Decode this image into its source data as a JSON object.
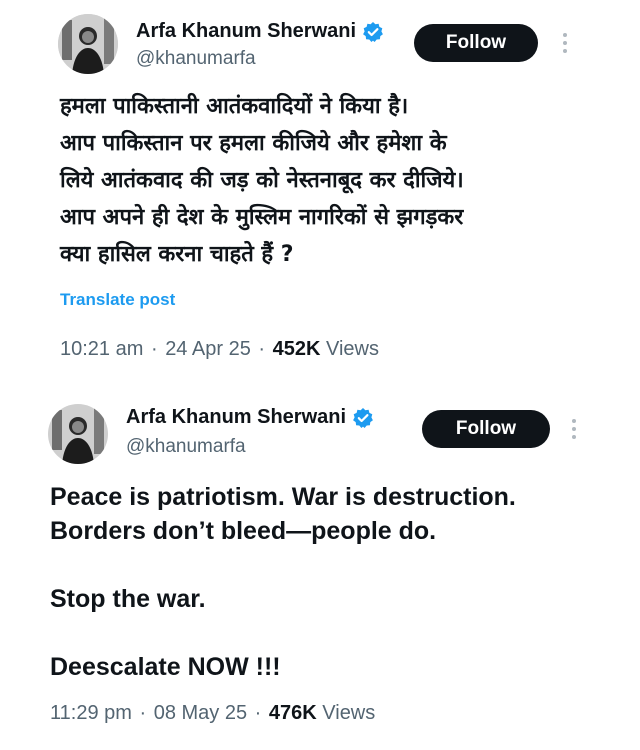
{
  "tweets": [
    {
      "author": {
        "display_name": "Arfa Khanum Sherwani",
        "handle": "@khanumarfa",
        "verified": true,
        "verified_color": "#1d9bf0"
      },
      "follow_label": "Follow",
      "text_lines": [
        "हमला पाकिस्तानी आतंकवादियों ने किया है।",
        "आप पाकिस्तान पर हमला कीजिये और हमेशा के",
        "लिये आतंकवाद की जड़ को नेस्तनाबूद कर दीजिये।",
        "आप अपने ही देश के मुस्लिम नागरिकों से झगड़कर",
        "क्या हासिल करना चाहते हैं ?"
      ],
      "translate_label": "Translate post",
      "time": "10:21 am",
      "date": "24 Apr 25",
      "views_count": "452K",
      "views_label": "Views"
    },
    {
      "author": {
        "display_name": "Arfa Khanum Sherwani",
        "handle": "@khanumarfa",
        "verified": true,
        "verified_color": "#1d9bf0"
      },
      "follow_label": "Follow",
      "text_lines": [
        "Peace is patriotism. War is destruction.",
        "Borders don’t bleed—people do.",
        "",
        "Stop the war.",
        "",
        "Deescalate NOW !!!"
      ],
      "time": "11:29 pm",
      "date": "08 May 25",
      "views_count": "476K",
      "views_label": "Views"
    }
  ],
  "colors": {
    "text": "#0f1419",
    "secondary": "#536471",
    "link": "#1d9bf0",
    "button_bg": "#0f1419",
    "button_text": "#ffffff"
  },
  "icons": {
    "verified": "verified-badge-icon",
    "more": "more-vertical-icon",
    "separator": "·"
  }
}
